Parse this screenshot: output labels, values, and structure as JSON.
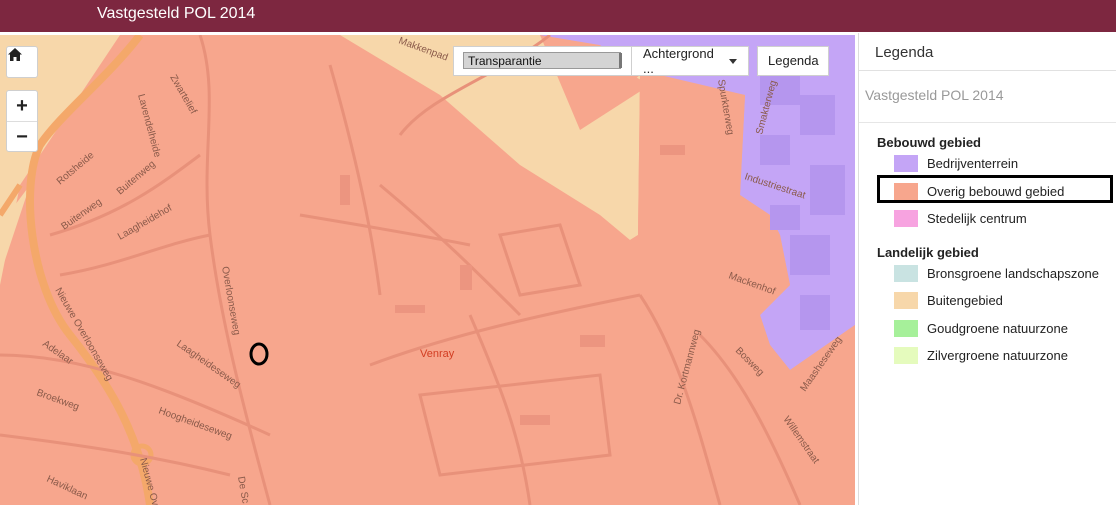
{
  "app": {
    "title": "Vastgesteld POL 2014"
  },
  "toolbar": {
    "transparency_label": "Transparantie",
    "background_label": "Achtergrond ...",
    "legend_label": "Legenda"
  },
  "map_controls": {
    "home_icon": "home-icon",
    "zoom_in": "+",
    "zoom_out": "−"
  },
  "map_labels": {
    "city": "Venray",
    "streets": [
      "Zwartelief",
      "Lavendelheide",
      "Rotsheide",
      "Buitenweg",
      "Buitenweg",
      "Laagheidehof",
      "Overloonseweg",
      "Nieuwe Overloonseweg",
      "Adelaar",
      "Broekweg",
      "Laagheideseweg",
      "Hoogheideseweg",
      "Haviklaan",
      "Nieuwe Ov",
      "De Sc",
      "Makkenpad",
      "Spurkterweg",
      "Smakterweg",
      "Industriestraat",
      "Mackenhof",
      "Dr. Kortmannweg",
      "Bosweg",
      "Maasheseweg",
      "Willemstraat"
    ]
  },
  "legend": {
    "header": "Legenda",
    "layer_title": "Vastgesteld POL 2014",
    "groups": [
      {
        "name": "Bebouwd gebied",
        "items": [
          {
            "label": "Bedrijventerrein",
            "color": "#c4a5f6"
          },
          {
            "label": "Overig bebouwd gebied",
            "color": "#f7a68d"
          },
          {
            "label": "Stedelijk centrum",
            "color": "#f7a3e0"
          }
        ]
      },
      {
        "name": "Landelijk gebied",
        "items": [
          {
            "label": "Bronsgroene landschapszone",
            "color": "#c9e3e2"
          },
          {
            "label": "Buitengebied",
            "color": "#f7d7aa"
          },
          {
            "label": "Goudgroene natuurzone",
            "color": "#a6f09a"
          },
          {
            "label": "Zilvergroene natuurzone",
            "color": "#e5fbbd"
          }
        ]
      }
    ]
  },
  "colors": {
    "titlebar": "#7d2740",
    "overig": "#f7a68d",
    "buitengebied": "#f7d7aa",
    "bedrijf": "#c4a5f6",
    "road": "#e8917a",
    "highway": "#f4a86a"
  }
}
